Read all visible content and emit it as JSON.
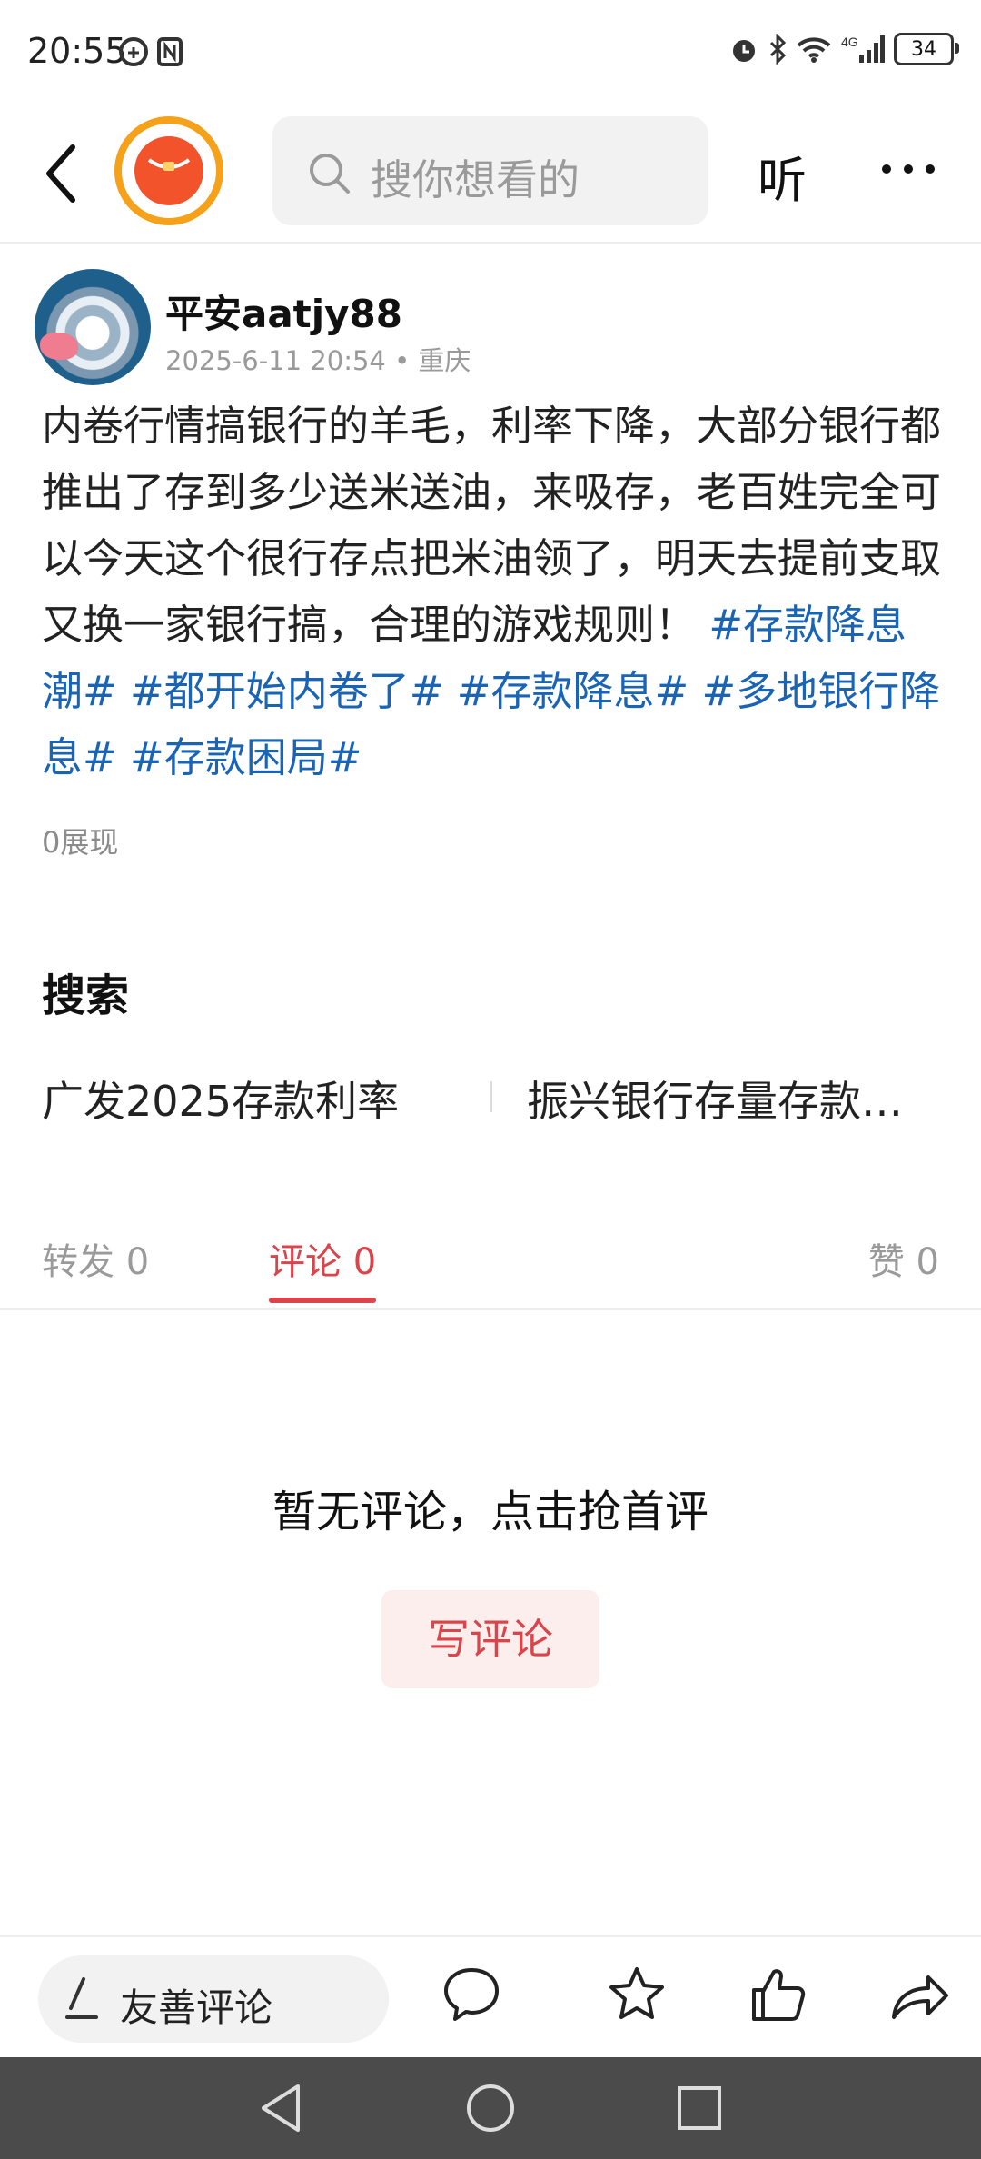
{
  "status_bar": {
    "time": "20:55",
    "battery": "34",
    "network": "4G"
  },
  "header": {
    "search_placeholder": "搜你想看的",
    "listen_label": "听"
  },
  "post": {
    "author": "平安aatjy88",
    "meta": "2025-6-11 20:54 • 重庆",
    "body_text": "内卷行情搞银行的羊毛，利率下降，大部分银行都推出了存到多少送米送油，来吸存，老百姓完全可以今天这个很行存点把米油领了，明天去提前支取又换一家银行搞，合理的游戏规则！",
    "hashtags": [
      "#存款降息潮#",
      "#都开始内卷了#",
      "#存款降息#",
      "#多地银行降息#",
      "#存款困局#"
    ],
    "views": "0展现"
  },
  "search_section": {
    "title": "搜索",
    "suggestions": [
      "广发2025存款利率",
      "振兴银行存量存款…"
    ]
  },
  "tabs": {
    "forward": "转发 0",
    "comment": "评论 0",
    "like": "赞 0"
  },
  "comments": {
    "empty_text": "暂无评论，点击抢首评",
    "write_button": "写评论"
  },
  "bottom_bar": {
    "input_placeholder": "友善评论"
  },
  "colors": {
    "accent_red": "#d9454a",
    "hashtag_blue": "#1a64b6"
  }
}
